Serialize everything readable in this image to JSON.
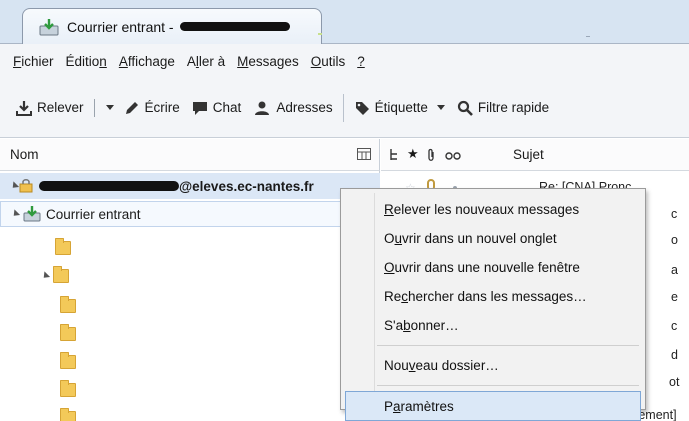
{
  "tab": {
    "title": "Courrier entrant -",
    "redacted": true
  },
  "menubar": [
    {
      "pre": "",
      "u": "F",
      "post": "ichier"
    },
    {
      "pre": "Éditio",
      "u": "n",
      "post": ""
    },
    {
      "pre": "",
      "u": "A",
      "post": "ffichage"
    },
    {
      "pre": "A",
      "u": "l",
      "post": "ler à"
    },
    {
      "pre": "",
      "u": "M",
      "post": "essages"
    },
    {
      "pre": "",
      "u": "O",
      "post": "utils"
    },
    {
      "pre": "",
      "u": "?",
      "post": ""
    }
  ],
  "toolbar": {
    "get_mail": "Relever",
    "write": "Écrire",
    "chat": "Chat",
    "addresses": "Adresses",
    "tag": "Étiquette",
    "quick_filter": "Filtre rapide"
  },
  "folder_pane": {
    "header": "Nom",
    "account_suffix": "@eleves.ec-nantes.fr",
    "inbox_label": "Courrier entrant"
  },
  "message_pane": {
    "subject_header": "Sujet",
    "rows": [
      {
        "subject": "Re: [CNA] Pronc"
      },
      {
        "subject": "c"
      },
      {
        "subject": "o"
      },
      {
        "subject": "a"
      },
      {
        "subject": "e"
      },
      {
        "subject": "c"
      },
      {
        "subject": "d"
      },
      {
        "subject": "ot"
      },
      {
        "subject": "Re: [Stage Recrutement]"
      }
    ]
  },
  "context_menu": [
    {
      "pre": "",
      "u": "R",
      "post": "elever les nouveaux messages"
    },
    {
      "pre": "O",
      "u": "u",
      "post": "vrir dans un nouvel onglet"
    },
    {
      "pre": "",
      "u": "O",
      "post": "uvrir dans une nouvelle fenêtre"
    },
    {
      "pre": "Re",
      "u": "c",
      "post": "hercher dans les messages…"
    },
    {
      "pre": "S'a",
      "u": "b",
      "post": "onner…"
    },
    {
      "pre": "Nou",
      "u": "v",
      "post": "eau dossier…"
    },
    {
      "pre": "P",
      "u": "a",
      "post": "ramètres"
    }
  ],
  "icons": {
    "tab_icon": "inbox-download-icon",
    "get_mail": "download-tray-icon",
    "write": "pencil-icon",
    "chat": "chat-bubble-icon",
    "addresses": "people-icon",
    "tag": "tag-icon",
    "quick_filter": "magnifier-icon"
  },
  "colors": {
    "selection": "#dbe8f7",
    "selection_border": "#7fa7d6",
    "folder": "#f3c959",
    "inbox_green": "#3aa24a"
  }
}
